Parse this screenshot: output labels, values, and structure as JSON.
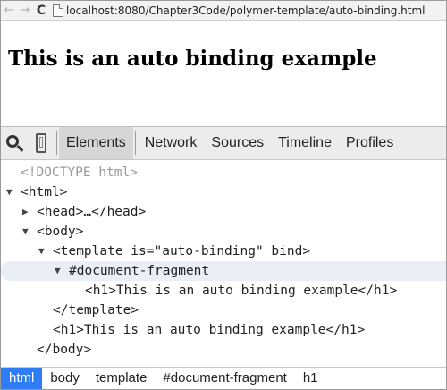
{
  "address_bar": {
    "back_glyph": "←",
    "forward_glyph": "→",
    "reload_glyph": "C",
    "url": "localhost:8080/Chapter3Code/polymer-template/auto-binding.html"
  },
  "page": {
    "heading": "This is an auto binding example"
  },
  "devtools": {
    "tabs": [
      {
        "label": "Elements",
        "active": true
      },
      {
        "label": "Network"
      },
      {
        "label": "Sources"
      },
      {
        "label": "Timeline"
      },
      {
        "label": "Profiles"
      }
    ],
    "tree": [
      {
        "text": "<!DOCTYPE html>",
        "twisty": ""
      },
      {
        "text": "<html>",
        "twisty": "▼"
      },
      {
        "text": "<head>…</head>",
        "twisty": "▶"
      },
      {
        "text": "<body>",
        "twisty": "▼"
      },
      {
        "text": "<template is=\"auto-binding\" bind>",
        "twisty": "▼"
      },
      {
        "text": "#document-fragment",
        "twisty": "▼",
        "selected": true
      },
      {
        "text": "<h1>This is an auto binding example</h1>",
        "twisty": ""
      },
      {
        "text": "</template>",
        "twisty": ""
      },
      {
        "text": "<h1>This is an auto binding example</h1>",
        "twisty": ""
      },
      {
        "text": "</body>",
        "twisty": ""
      }
    ],
    "breadcrumbs": [
      {
        "label": "html",
        "active": true
      },
      {
        "label": "body"
      },
      {
        "label": "template"
      },
      {
        "label": "#document-fragment"
      },
      {
        "label": "h1"
      }
    ]
  },
  "colors": {
    "selected_row": "#eaeef6",
    "breadcrumb_active": "#2e7cf6",
    "doctype_text": "#9a9a9a"
  }
}
